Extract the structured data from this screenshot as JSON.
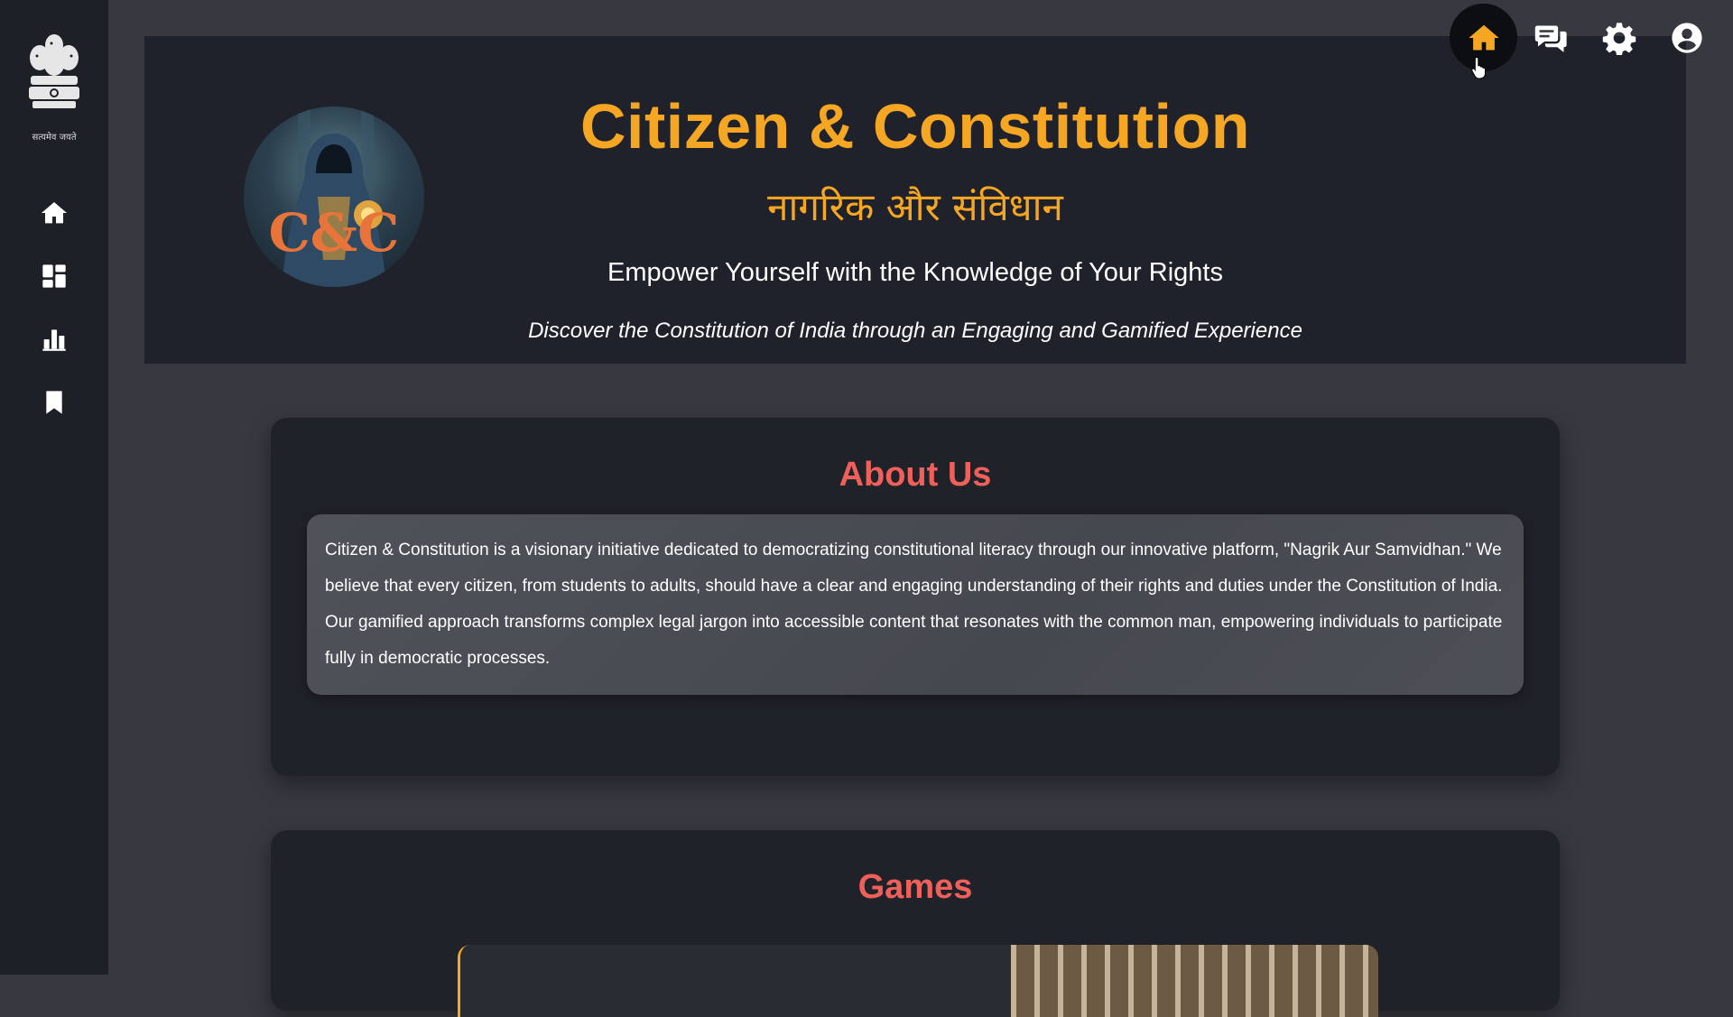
{
  "sidebar": {
    "emblem_caption": "सत्यमेव जयते",
    "items": [
      {
        "icon": "home-icon",
        "label": "Home"
      },
      {
        "icon": "dashboard-icon",
        "label": "Dashboard"
      },
      {
        "icon": "bar-chart-icon",
        "label": "Leaderboard"
      },
      {
        "icon": "bookmark-icon",
        "label": "Bookmarks"
      }
    ]
  },
  "topbar": {
    "items": [
      {
        "icon": "home-icon",
        "active": true
      },
      {
        "icon": "chat-icon",
        "active": false
      },
      {
        "icon": "gear-icon",
        "active": false
      },
      {
        "icon": "user-icon",
        "active": false
      }
    ],
    "accent_color": "#f5a623"
  },
  "hero": {
    "title": "Citizen & Constitution",
    "hindi_title": "नागरिक और संविधान",
    "tagline": "Empower Yourself with the Knowledge of Your Rights",
    "subtitle": "Discover the Constitution of India through an Engaging and Gamified Experience",
    "logo_text": "C&C"
  },
  "about": {
    "title": "About Us",
    "body": "Citizen & Constitution is a visionary initiative dedicated to democratizing constitutional literacy through our innovative platform, \"Nagrik Aur Samvidhan.\" We believe that every citizen, from students to adults, should have a clear and engaging understanding of their rights and duties under the Constitution of India. Our gamified approach transforms complex legal jargon into accessible content that resonates with the common man, empowering individuals to participate fully in democratic processes."
  },
  "games": {
    "title": "Games"
  },
  "colors": {
    "accent": "#f5a623",
    "section_title": "#f0605a",
    "background": "#373840",
    "sidebar": "#1e2028"
  }
}
